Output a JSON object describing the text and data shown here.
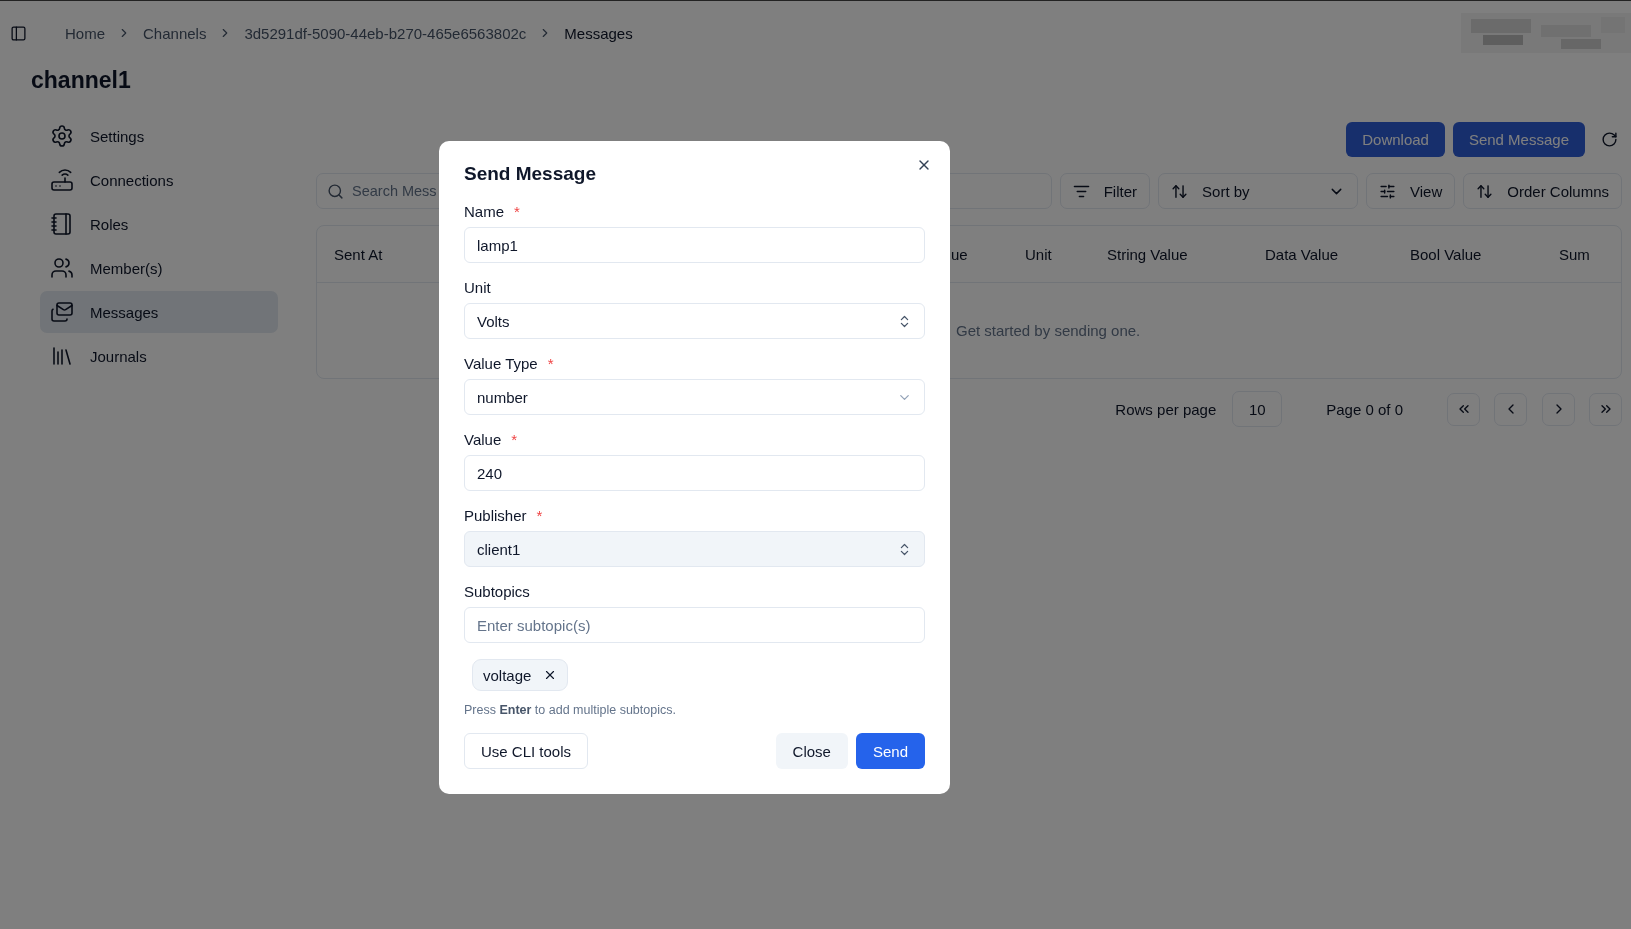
{
  "breadcrumb": [
    {
      "label": "Home"
    },
    {
      "label": "Channels"
    },
    {
      "label": "3d5291df-5090-44eb-b270-465e6563802c"
    },
    {
      "label": "Messages",
      "current": true
    }
  ],
  "page_title": "channel1",
  "sidebar": {
    "items": [
      {
        "label": "Settings",
        "selected": false
      },
      {
        "label": "Connections",
        "selected": false
      },
      {
        "label": "Roles",
        "selected": false
      },
      {
        "label": "Member(s)",
        "selected": false
      },
      {
        "label": "Messages",
        "selected": true
      },
      {
        "label": "Journals",
        "selected": false
      }
    ]
  },
  "actions": [
    {
      "label": "Download"
    },
    {
      "label": "Send Message"
    }
  ],
  "search": {
    "placeholder": "Search Mess"
  },
  "toolbar": [
    {
      "label": "Filter"
    },
    {
      "label": "Sort by",
      "dropdown": true
    },
    {
      "label": "View"
    },
    {
      "label": "Order Columns"
    }
  ],
  "table": {
    "columns": [
      "Sent At",
      "ue",
      "Unit",
      "String Value",
      "Data Value",
      "Bool Value",
      "Sum"
    ],
    "empty_message": "Get started by sending one."
  },
  "pagination": {
    "rows_label": "Rows per page",
    "rows_value": "10",
    "page_label": "Page 0 of 0"
  },
  "dialog": {
    "title": "Send Message",
    "fields": [
      {
        "label": "Name",
        "marker": "*",
        "kind": "input",
        "value": "lamp1"
      },
      {
        "label": "Unit",
        "kind": "combobox",
        "value": "Volts",
        "disabled": false
      },
      {
        "label": "Value Type",
        "marker": "*",
        "kind": "select",
        "value": "number"
      },
      {
        "label": "Value",
        "marker": "*",
        "kind": "input",
        "value": "240"
      },
      {
        "label": "Publisher",
        "marker": "*",
        "kind": "combobox",
        "value": "client1",
        "disabled": true
      },
      {
        "label": "Subtopics",
        "kind": "input",
        "placeholder": "Enter subtopic(s)"
      }
    ],
    "chips": [
      {
        "label": "voltage"
      }
    ],
    "hint": "Press **Enter** to add multiple subtopics.",
    "buttons": [
      {
        "label": "Use CLI tools",
        "kind": "outline"
      },
      {
        "label": "Close",
        "kind": "secondary"
      },
      {
        "label": "Send",
        "kind": "primary"
      }
    ]
  }
}
